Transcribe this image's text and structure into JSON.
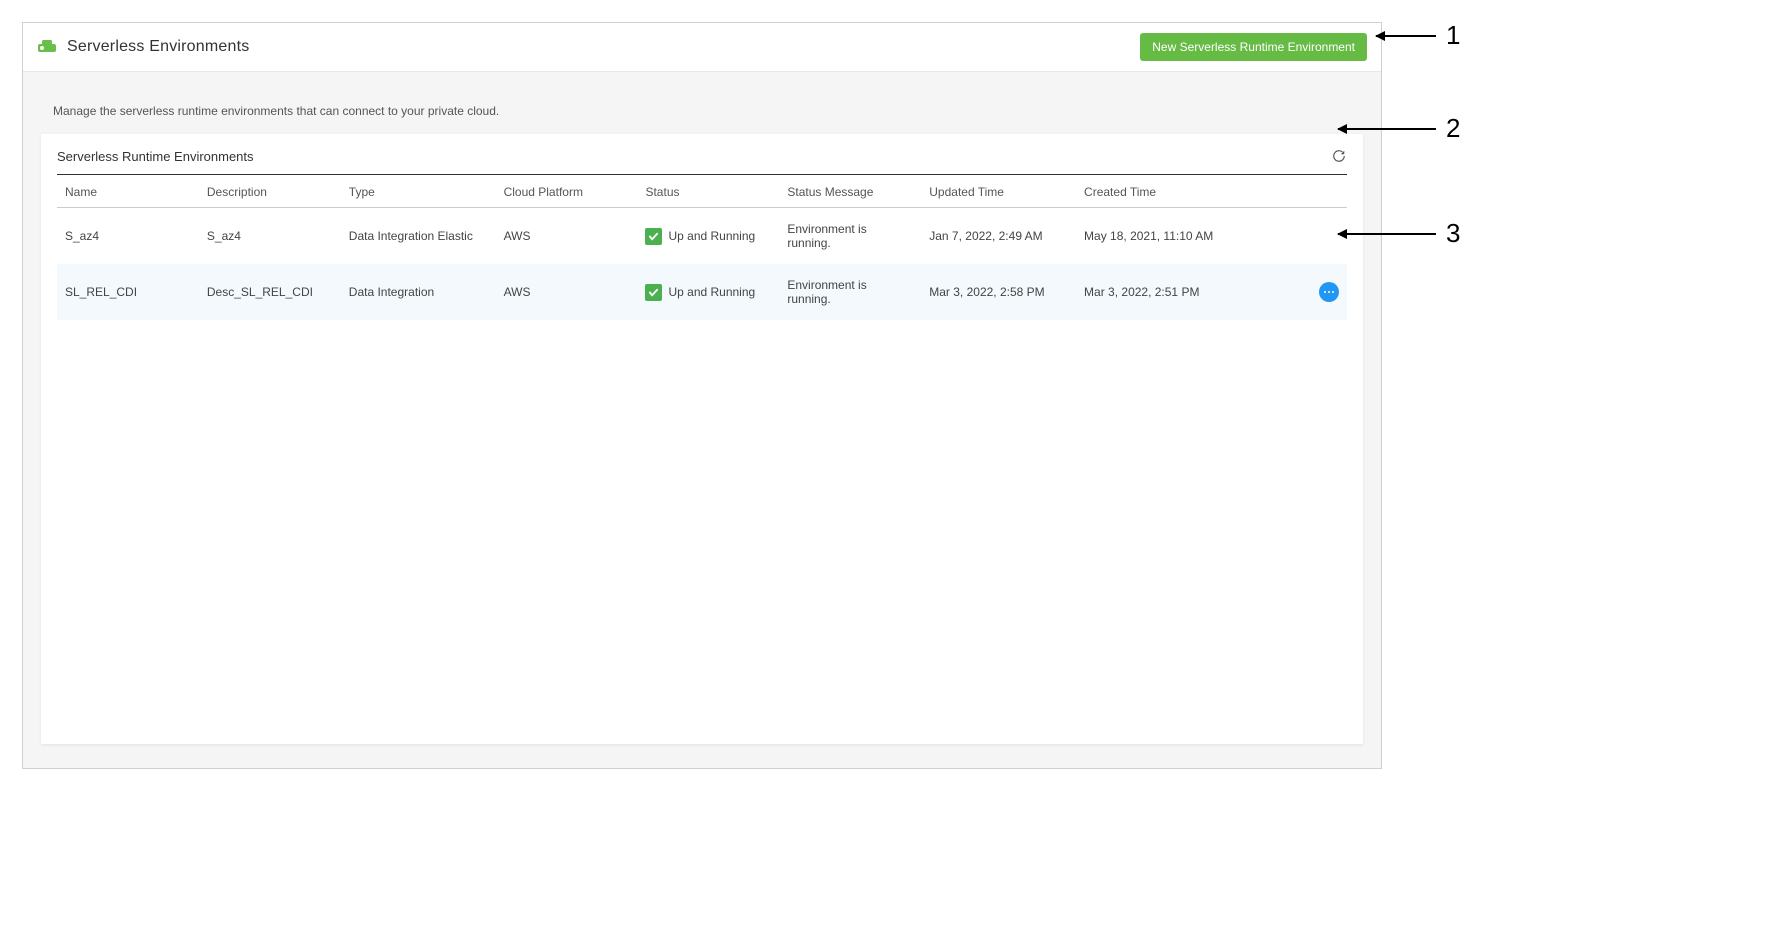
{
  "header": {
    "title": "Serverless Environments",
    "new_button_label": "New Serverless Runtime Environment"
  },
  "subtitle": "Manage the serverless runtime environments that can connect to your private cloud.",
  "panel": {
    "title": "Serverless Runtime Environments"
  },
  "columns": {
    "name": "Name",
    "description": "Description",
    "type": "Type",
    "cloud_platform": "Cloud Platform",
    "status": "Status",
    "status_message": "Status Message",
    "updated_time": "Updated Time",
    "created_time": "Created Time"
  },
  "rows": [
    {
      "name": "S_az4",
      "description": "S_az4",
      "type": "Data Integration Elastic",
      "cloud_platform": "AWS",
      "status": "Up and Running",
      "status_message": "Environment is running.",
      "updated_time": "Jan 7, 2022, 2:49 AM",
      "created_time": "May 18, 2021, 11:10 AM"
    },
    {
      "name": "SL_REL_CDI",
      "description": "Desc_SL_REL_CDI",
      "type": "Data Integration",
      "cloud_platform": "AWS",
      "status": "Up and Running",
      "status_message": "Environment is running.",
      "updated_time": "Mar 3, 2022, 2:58 PM",
      "created_time": "Mar 3, 2022, 2:51 PM"
    }
  ],
  "callouts": {
    "one": "1",
    "two": "2",
    "three": "3"
  }
}
